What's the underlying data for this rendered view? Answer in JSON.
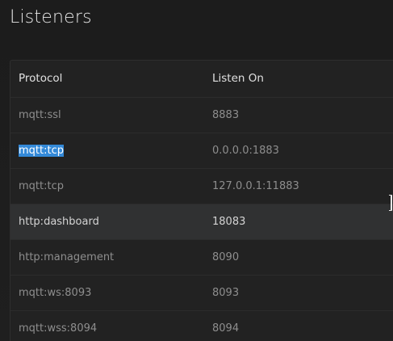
{
  "page": {
    "title": "Listeners"
  },
  "table": {
    "columns": [
      "Protocol",
      "Listen On"
    ],
    "rows": [
      {
        "protocol": "mqtt:ssl",
        "listen_on": "8883"
      },
      {
        "protocol": "mqtt:tcp",
        "listen_on": "0.0.0.0:1883",
        "selected_text": true
      },
      {
        "protocol": "mqtt:tcp",
        "listen_on": "127.0.0.1:11883"
      },
      {
        "protocol": "http:dashboard",
        "listen_on": "18083",
        "hovered": true
      },
      {
        "protocol": "http:management",
        "listen_on": "8090"
      },
      {
        "protocol": "mqtt:ws:8093",
        "listen_on": "8093"
      },
      {
        "protocol": "mqtt:wss:8094",
        "listen_on": "8094"
      }
    ]
  },
  "colors": {
    "background": "#1d1d1d",
    "card": "#222222",
    "hover_row": "#303132",
    "text_selection": "#3389d8"
  }
}
